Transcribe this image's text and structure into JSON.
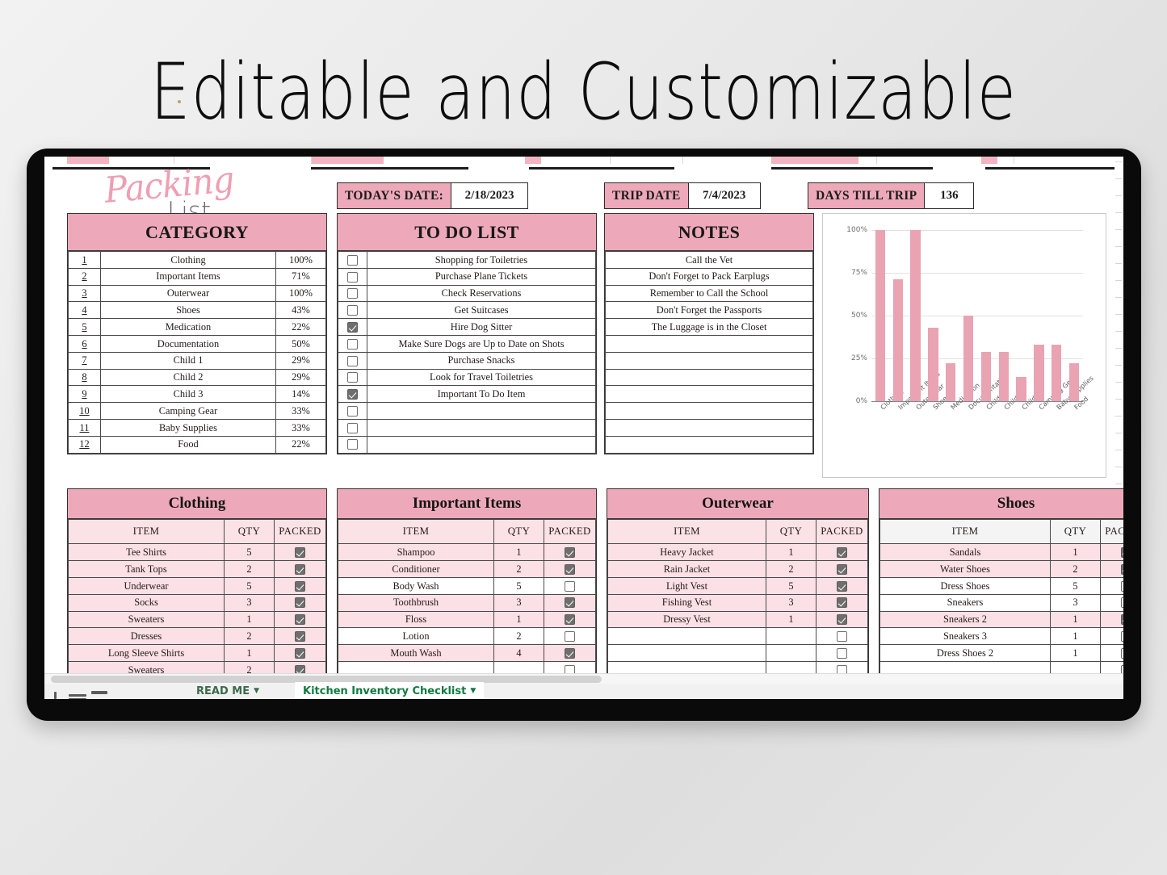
{
  "headline": "Editable and Customizable",
  "logo": {
    "script_word": "Packing",
    "plain_word": "List"
  },
  "info_boxes": [
    {
      "label": "TODAY'S DATE:",
      "value": "2/18/2023"
    },
    {
      "label": "TRIP DATE",
      "value": "7/4/2023"
    },
    {
      "label": "DAYS TILL TRIP",
      "value": "136"
    }
  ],
  "category_panel": {
    "title": "CATEGORY",
    "rows": [
      {
        "num": "1",
        "name": "Clothing",
        "pct": "100%"
      },
      {
        "num": "2",
        "name": "Important Items",
        "pct": "71%"
      },
      {
        "num": "3",
        "name": "Outerwear",
        "pct": "100%"
      },
      {
        "num": "4",
        "name": "Shoes",
        "pct": "43%"
      },
      {
        "num": "5",
        "name": "Medication",
        "pct": "22%"
      },
      {
        "num": "6",
        "name": "Documentation",
        "pct": "50%"
      },
      {
        "num": "7",
        "name": "Child 1",
        "pct": "29%"
      },
      {
        "num": "8",
        "name": "Child 2",
        "pct": "29%"
      },
      {
        "num": "9",
        "name": "Child 3",
        "pct": "14%"
      },
      {
        "num": "10",
        "name": "Camping Gear",
        "pct": "33%"
      },
      {
        "num": "11",
        "name": "Baby Supplies",
        "pct": "33%"
      },
      {
        "num": "12",
        "name": "Food",
        "pct": "22%"
      }
    ]
  },
  "todo_panel": {
    "title": "TO DO LIST",
    "rows": [
      {
        "checked": false,
        "text": "Shopping for Toiletries"
      },
      {
        "checked": false,
        "text": "Purchase Plane Tickets"
      },
      {
        "checked": false,
        "text": "Check Reservations"
      },
      {
        "checked": false,
        "text": "Get Suitcases"
      },
      {
        "checked": true,
        "text": "Hire Dog Sitter"
      },
      {
        "checked": false,
        "text": "Make Sure Dogs are Up to Date on Shots"
      },
      {
        "checked": false,
        "text": "Purchase Snacks"
      },
      {
        "checked": false,
        "text": "Look for Travel Toiletries"
      },
      {
        "checked": true,
        "text": "Important To Do Item"
      },
      {
        "checked": false,
        "text": ""
      },
      {
        "checked": false,
        "text": ""
      },
      {
        "checked": false,
        "text": ""
      }
    ]
  },
  "notes_panel": {
    "title": "NOTES",
    "rows": [
      "Call the Vet",
      "Don't Forget to Pack Earplugs",
      "Remember to Call the School",
      "Don't Forget the Passports",
      "The Luggage is in the Closet",
      "",
      "",
      "",
      "",
      "",
      "",
      ""
    ]
  },
  "chart_data": {
    "type": "bar",
    "title": "",
    "xlabel": "",
    "ylabel": "",
    "ylim": [
      0,
      100
    ],
    "ytick_labels": [
      "0%",
      "25%",
      "50%",
      "75%",
      "100%"
    ],
    "ytick_values": [
      0,
      25,
      50,
      75,
      100
    ],
    "grid": true,
    "legend": "none",
    "bar_color": "#e9a3b3",
    "categories": [
      "Clothing",
      "Important Items",
      "Outerwear",
      "Shoes",
      "Medication",
      "Documentation",
      "Child 1",
      "Child 2",
      "Child 3",
      "Camping Gear",
      "Baby Supplies",
      "Food"
    ],
    "values": [
      100,
      71,
      100,
      43,
      22,
      50,
      29,
      29,
      14,
      33,
      33,
      22
    ]
  },
  "item_tables": [
    {
      "title": "Clothing",
      "header_style": "pink",
      "columns": [
        "ITEM",
        "QTY",
        "PACKED"
      ],
      "rows": [
        {
          "item": "Tee Shirts",
          "qty": "5",
          "packed": true
        },
        {
          "item": "Tank Tops",
          "qty": "2",
          "packed": true
        },
        {
          "item": "Underwear",
          "qty": "5",
          "packed": true
        },
        {
          "item": "Socks",
          "qty": "3",
          "packed": true
        },
        {
          "item": "Sweaters",
          "qty": "1",
          "packed": true
        },
        {
          "item": "Dresses",
          "qty": "2",
          "packed": true
        },
        {
          "item": "Long Sleeve Shirts",
          "qty": "1",
          "packed": true
        },
        {
          "item": "Sweaters",
          "qty": "2",
          "packed": true
        },
        {
          "item": "",
          "qty": "",
          "packed": true
        }
      ]
    },
    {
      "title": "Important Items",
      "header_style": "pink",
      "columns": [
        "ITEM",
        "QTY",
        "PACKED"
      ],
      "rows": [
        {
          "item": "Shampoo",
          "qty": "1",
          "packed": true
        },
        {
          "item": "Conditioner",
          "qty": "2",
          "packed": true
        },
        {
          "item": "Body Wash",
          "qty": "5",
          "packed": false
        },
        {
          "item": "Toothbrush",
          "qty": "3",
          "packed": true
        },
        {
          "item": "Floss",
          "qty": "1",
          "packed": true
        },
        {
          "item": "Lotion",
          "qty": "2",
          "packed": false
        },
        {
          "item": "Mouth Wash",
          "qty": "4",
          "packed": true
        },
        {
          "item": "",
          "qty": "",
          "packed": false
        },
        {
          "item": "",
          "qty": "",
          "packed": false
        }
      ]
    },
    {
      "title": "Outerwear",
      "header_style": "pink",
      "columns": [
        "ITEM",
        "QTY",
        "PACKED"
      ],
      "rows": [
        {
          "item": "Heavy Jacket",
          "qty": "1",
          "packed": true
        },
        {
          "item": "Rain Jacket",
          "qty": "2",
          "packed": true
        },
        {
          "item": "Light Vest",
          "qty": "5",
          "packed": true
        },
        {
          "item": "Fishing Vest",
          "qty": "3",
          "packed": true
        },
        {
          "item": "Dressy Vest",
          "qty": "1",
          "packed": true
        },
        {
          "item": "",
          "qty": "",
          "packed": false
        },
        {
          "item": "",
          "qty": "",
          "packed": false
        },
        {
          "item": "",
          "qty": "",
          "packed": false
        },
        {
          "item": "",
          "qty": "",
          "packed": false
        }
      ]
    },
    {
      "title": "Shoes",
      "header_style": "grey",
      "columns": [
        "ITEM",
        "QTY",
        "PACKED"
      ],
      "rows": [
        {
          "item": "Sandals",
          "qty": "1",
          "packed": true
        },
        {
          "item": "Water Shoes",
          "qty": "2",
          "packed": true
        },
        {
          "item": "Dress Shoes",
          "qty": "5",
          "packed": false
        },
        {
          "item": "Sneakers",
          "qty": "3",
          "packed": false
        },
        {
          "item": "Sneakers 2",
          "qty": "1",
          "packed": true
        },
        {
          "item": "Sneakers 3",
          "qty": "1",
          "packed": false
        },
        {
          "item": "Dress Shoes 2",
          "qty": "1",
          "packed": false
        },
        {
          "item": "",
          "qty": "",
          "packed": false
        },
        {
          "item": "",
          "qty": "",
          "packed": false
        }
      ]
    }
  ],
  "sheet_tabs": [
    {
      "label": "READ ME",
      "active": false
    },
    {
      "label": "Kitchen Inventory Checklist",
      "active": true
    }
  ]
}
